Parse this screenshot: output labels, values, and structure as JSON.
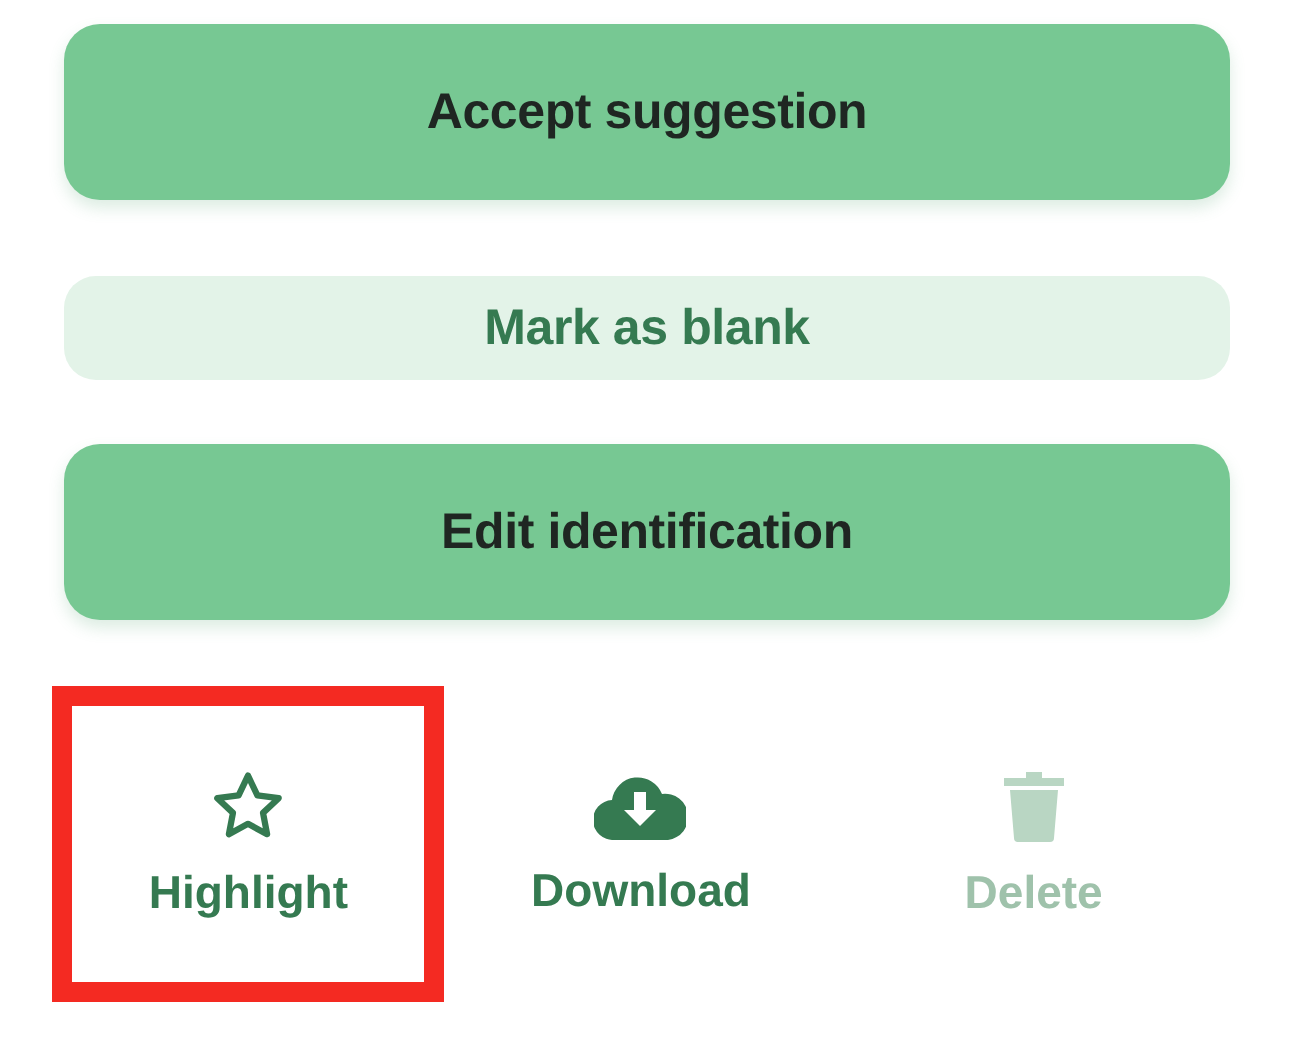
{
  "buttons": [
    {
      "label": "Accept suggestion",
      "kind": "primary"
    },
    {
      "label": "Mark as blank",
      "kind": "secondary"
    },
    {
      "label": "Edit identification",
      "kind": "primary"
    }
  ],
  "actions": [
    {
      "label": "Highlight",
      "kind": "star",
      "disabled": false,
      "outlined": true
    },
    {
      "label": "Download",
      "kind": "download",
      "disabled": false,
      "outlined": false
    },
    {
      "label": "Delete",
      "kind": "delete",
      "disabled": true,
      "outlined": false
    }
  ]
}
